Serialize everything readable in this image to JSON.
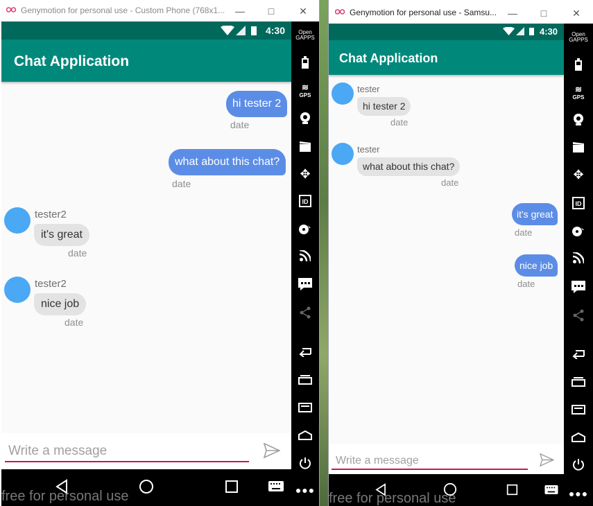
{
  "window_left": {
    "title": "Genymotion for personal use - Custom Phone (768x1...",
    "status_time": "4:30",
    "app_title": "Chat Application",
    "messages": [
      {
        "direction": "out",
        "text": "hi tester 2",
        "date": "date"
      },
      {
        "direction": "out",
        "text": "what about this chat?",
        "date": "date"
      },
      {
        "direction": "in",
        "sender": "tester2",
        "text": "it's great",
        "date": "date"
      },
      {
        "direction": "in",
        "sender": "tester2",
        "text": "nice job",
        "date": "date"
      }
    ],
    "input_placeholder": "Write a message",
    "watermark": "free for personal use"
  },
  "window_right": {
    "title": "Genymotion for personal use - Samsu...",
    "status_time": "4:30",
    "app_title": "Chat Application",
    "messages": [
      {
        "direction": "in",
        "sender": "tester",
        "text": "hi tester 2",
        "date": "date"
      },
      {
        "direction": "in",
        "sender": "tester",
        "text": "what about this chat?",
        "date": "date"
      },
      {
        "direction": "out",
        "text": "it's great",
        "date": "date"
      },
      {
        "direction": "out",
        "text": "nice job",
        "date": "date"
      }
    ],
    "input_placeholder": "Write a message",
    "watermark": "free for personal use"
  },
  "sidebar": {
    "open_gapps_line1": "Open",
    "open_gapps_line2": "GAPPS",
    "gps_label": "GPS",
    "id_label": "ID",
    "icons": [
      "battery-icon",
      "gps-icon",
      "camera-icon",
      "media-icon",
      "move-icon",
      "id-icon",
      "disk-icon",
      "rss-icon",
      "sms-icon",
      "share-icon",
      "back-icon",
      "recent-apps-icon",
      "menu-icon",
      "home-icon",
      "power-icon",
      "more-icon"
    ]
  },
  "colors": {
    "accent": "#00897b",
    "status": "#00695c",
    "bubble_out": "#5c8de6",
    "bubble_in": "#e3e3e3",
    "avatar": "#4aa8f5",
    "underline": "#c2185b"
  }
}
